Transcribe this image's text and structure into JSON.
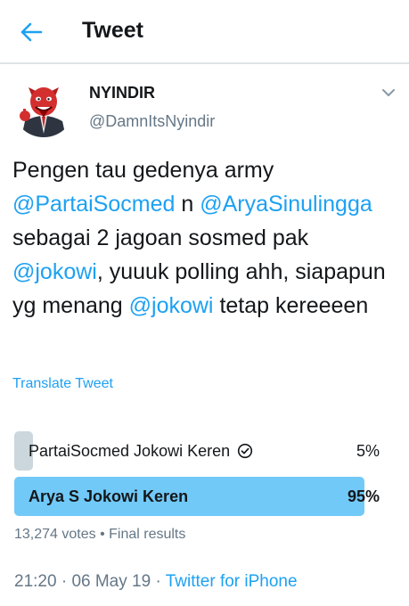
{
  "header": {
    "title": "Tweet"
  },
  "author": {
    "display_name": "NYINDIR",
    "handle": "@DamnItsNyindir"
  },
  "tweet": {
    "segments": [
      {
        "text": "Pengen tau gedenya army ",
        "mention": false
      },
      {
        "text": "@PartaiSocmed",
        "mention": true
      },
      {
        "text": " n ",
        "mention": false
      },
      {
        "text": "@AryaSinulingga",
        "mention": true
      },
      {
        "text": " sebagai 2 jagoan sosmed pak ",
        "mention": false
      },
      {
        "text": "@jokowi",
        "mention": true
      },
      {
        "text": ", yuuuk polling ahh, siapapun yg menang ",
        "mention": false
      },
      {
        "text": "@jokowi",
        "mention": true
      },
      {
        "text": " tetap kereeeen",
        "mention": false
      }
    ],
    "translate_label": "Translate Tweet"
  },
  "poll": {
    "options": [
      {
        "label": "PartaiSocmed Jokowi Keren",
        "percent_label": "5%",
        "fraction": 0.05,
        "voted": true,
        "winner": false
      },
      {
        "label": "Arya S Jokowi Keren",
        "percent_label": "95%",
        "fraction": 0.95,
        "voted": false,
        "winner": true
      }
    ],
    "votes": "13,274 votes",
    "separator": " • ",
    "status": "Final results"
  },
  "meta": {
    "time": "21:20",
    "date": "06 May 19",
    "separator": " · ",
    "source": "Twitter for iPhone"
  },
  "colors": {
    "accent": "#1da1f2",
    "winner_bar": "#71c9f8",
    "loser_bar": "#ccd6dd",
    "secondary_text": "#657786"
  }
}
